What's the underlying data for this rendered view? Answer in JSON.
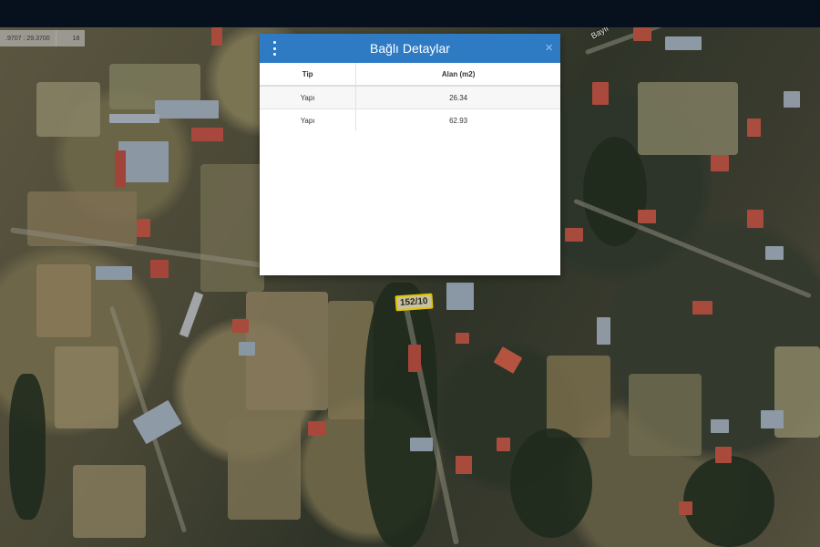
{
  "coordinates": {
    "position": ".9707 : 29.3700",
    "zoom": "18"
  },
  "map": {
    "street_label": "Bayır",
    "parcel_label": "152/10"
  },
  "dialog": {
    "title": "Bağlı Detaylar",
    "close_label": "×",
    "columns": [
      "Tip",
      "Alan (m2)"
    ],
    "rows": [
      {
        "tip": "Yapı",
        "alan": "26.34"
      },
      {
        "tip": "Yapı",
        "alan": "62.93"
      }
    ]
  }
}
